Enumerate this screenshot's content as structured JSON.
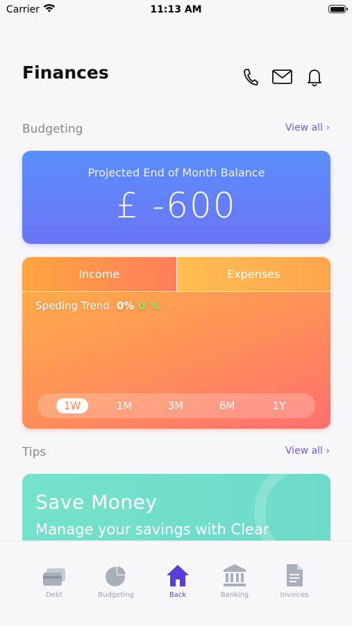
{
  "status_bar": {
    "carrier": "Carrier",
    "time": "11:13 AM"
  },
  "header": {
    "title": "Finances",
    "icons": [
      "phone-icon",
      "mail-icon",
      "bell-icon"
    ]
  },
  "budgeting": {
    "section_title": "Budgeting",
    "view_all": "View all ›",
    "balance_label": "Projected End of Month Balance",
    "balance_value": "£ -600"
  },
  "trend_card": {
    "tabs": [
      "Income",
      "Expenses"
    ],
    "trend_label": "Speding Trend",
    "trend_pct": "0%",
    "trend_pct_secondary": "0 %",
    "ranges": [
      "1W",
      "1M",
      "3M",
      "6M",
      "1Y"
    ],
    "selected_range": "1W"
  },
  "tips": {
    "section_title": "Tips",
    "view_all": "View all ›",
    "card_title": "Save Money",
    "card_subtitle": "Manage your savings with Clear"
  },
  "tab_bar": {
    "items": [
      {
        "label": "Debt",
        "icon": "card-icon"
      },
      {
        "label": "Budgeting",
        "icon": "pie-chart-icon"
      },
      {
        "label": "Back",
        "icon": "home-icon"
      },
      {
        "label": "Banking",
        "icon": "bank-icon"
      },
      {
        "label": "Invoices",
        "icon": "document-icon"
      }
    ],
    "active": "Back"
  },
  "colors": {
    "accent": "#6c5ce7",
    "active_tab": "#5a3fd6",
    "balance_card": "#5a8ffb",
    "trend_card": "#ff9158",
    "tips_card": "#75e2cb"
  }
}
